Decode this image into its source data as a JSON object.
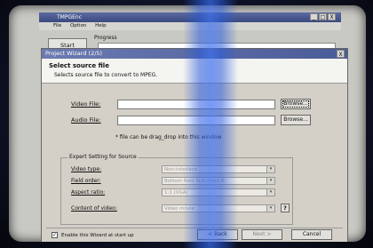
{
  "app": {
    "title": "TMPGEnc",
    "window_controls": [
      "_",
      "□",
      "X"
    ],
    "menu": [
      "File",
      "Option",
      "Help"
    ],
    "start_label": "Start",
    "progress_label": "Progress"
  },
  "wizard": {
    "title": "Project Wizard (2/5)",
    "close_label": "X",
    "heading": "Select source file",
    "subheading": "Selects source file to convert to MPEG.",
    "video_file": {
      "label": "Video File:",
      "value": "",
      "browse_label": "Browse..."
    },
    "audio_file": {
      "label": "Audio File:",
      "value": "",
      "browse_label": "Browse..."
    },
    "drag_hint": "* file can be drag_drop into this window",
    "expert": {
      "title": "Expert Setting for Source",
      "video_type": {
        "label": "Video type:",
        "value": "Non-interlace"
      },
      "field_order": {
        "label": "Field order:",
        "value": "Bottom field first (field B)"
      },
      "aspect_ratio": {
        "label": "Aspect ratio:",
        "value": "1:1 (VGA)"
      },
      "content": {
        "label": "Content of video:",
        "value": "Video movie"
      },
      "help_label": "?"
    },
    "enable_wizard": {
      "label": "Enable this Wizard at start up",
      "checked": true
    },
    "back_label": "< Back",
    "next_label": "Next >",
    "cancel_label": "Cancel"
  },
  "colors": {
    "titlebar": "#4a5c98",
    "dialog_face": "#d4d0c8",
    "streak": "#3c6ef0"
  }
}
